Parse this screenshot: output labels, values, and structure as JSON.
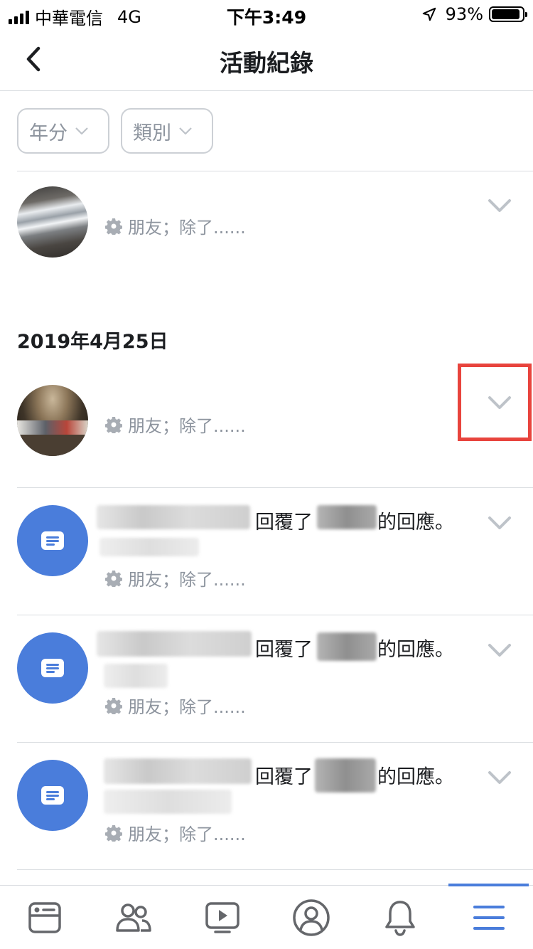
{
  "status_bar": {
    "carrier": "中華電信",
    "network": "4G",
    "time": "下午3:49",
    "battery": "93%",
    "battery_level": 0.93
  },
  "header": {
    "title": "活動紀錄",
    "back_icon": "chevron-left-icon"
  },
  "filters": [
    {
      "label": "年分",
      "icon": "caret-down-icon"
    },
    {
      "label": "類別",
      "icon": "caret-down-icon"
    }
  ],
  "date_header": "2019年4月25日",
  "activities": [
    {
      "avatar": "photo",
      "privacy": "朋友；除了......"
    },
    {
      "avatar": "photo",
      "privacy": "朋友；除了......"
    },
    {
      "avatar": "comment-icon",
      "action": "回覆了",
      "suffix": "的回應。",
      "privacy": "朋友；除了......"
    },
    {
      "avatar": "comment-icon",
      "action": "回覆了",
      "suffix": "的回應。",
      "privacy": "朋友；除了......"
    },
    {
      "avatar": "comment-icon",
      "action": "回覆了",
      "suffix": "的回應。",
      "privacy": "朋友；除了......"
    }
  ],
  "tabs": [
    {
      "icon": "news-feed-icon"
    },
    {
      "icon": "friends-icon"
    },
    {
      "icon": "watch-icon"
    },
    {
      "icon": "profile-icon"
    },
    {
      "icon": "notifications-icon"
    },
    {
      "icon": "menu-icon",
      "active": true
    }
  ],
  "colors": {
    "accent": "#4a7ddb",
    "highlight": "#e8443d",
    "muted_text": "#8d949e",
    "divider": "#dadde1"
  }
}
